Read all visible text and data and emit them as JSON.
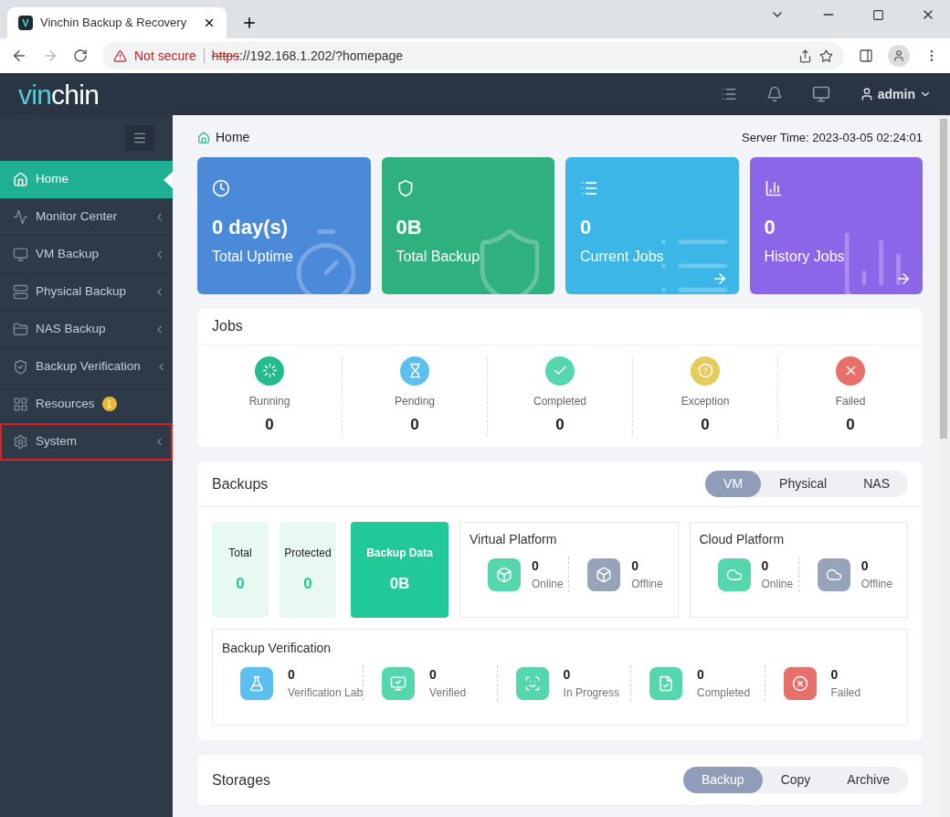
{
  "browser": {
    "tab_title": "Vinchin Backup & Recovery",
    "tab_icon_letter": "V",
    "security": "Not secure",
    "scheme": "https",
    "url_rest": "://192.168.1.202/?homepage"
  },
  "header": {
    "logo_accent": "vin",
    "logo_rest": "chin",
    "user": "admin"
  },
  "sidebar": {
    "items": [
      {
        "label": "Home",
        "selected": true,
        "highlighted": false,
        "expandable": false
      },
      {
        "label": "Monitor Center",
        "selected": false,
        "highlighted": false,
        "expandable": true
      },
      {
        "label": "VM Backup",
        "selected": false,
        "highlighted": false,
        "expandable": true
      },
      {
        "label": "Physical Backup",
        "selected": false,
        "highlighted": false,
        "expandable": true
      },
      {
        "label": "NAS Backup",
        "selected": false,
        "highlighted": false,
        "expandable": true
      },
      {
        "label": "Backup Verification",
        "selected": false,
        "highlighted": false,
        "expandable": true
      },
      {
        "label": "Resources",
        "selected": false,
        "highlighted": false,
        "expandable": false,
        "badge": "1"
      },
      {
        "label": "System",
        "selected": false,
        "highlighted": true,
        "expandable": true
      }
    ]
  },
  "breadcrumb": "Home",
  "server_time": "Server Time: 2023-03-05 02:24:01",
  "stat_cards": [
    {
      "kind": "uptime",
      "value": "0 day(s)",
      "label": "Total Uptime",
      "color": "#4a8ad8",
      "arrow": false
    },
    {
      "kind": "backup",
      "value": "0B",
      "label": "Total Backup",
      "color": "#2fb07f",
      "arrow": false
    },
    {
      "kind": "current",
      "value": "0",
      "label": "Current Jobs",
      "color": "#3bb6e6",
      "arrow": true
    },
    {
      "kind": "history",
      "value": "0",
      "label": "History Jobs",
      "color": "#8c66e8",
      "arrow": true
    }
  ],
  "jobs": {
    "title": "Jobs",
    "items": [
      {
        "kind": "running",
        "label": "Running",
        "value": "0",
        "color": "#22bb8c"
      },
      {
        "kind": "pending",
        "label": "Pending",
        "value": "0",
        "color": "#5bc0f0"
      },
      {
        "kind": "completed",
        "label": "Completed",
        "value": "0",
        "color": "#55d6ac"
      },
      {
        "kind": "exception",
        "label": "Exception",
        "value": "0",
        "color": "#e6cc5c"
      },
      {
        "kind": "failed",
        "label": "Failed",
        "value": "0",
        "color": "#e8706a"
      }
    ]
  },
  "backups": {
    "title": "Backups",
    "tabs": [
      {
        "label": "VM",
        "selected": true
      },
      {
        "label": "Physical",
        "selected": false
      },
      {
        "label": "NAS",
        "selected": false
      }
    ],
    "summary": [
      {
        "label": "Total",
        "value": "0",
        "highlight": false
      },
      {
        "label": "Protected",
        "value": "0",
        "highlight": false
      },
      {
        "label": "Backup Data",
        "value": "0B",
        "highlight": true
      }
    ],
    "platforms": [
      {
        "title": "Virtual Platform",
        "kind": "virtual",
        "items": [
          {
            "value": "0",
            "label": "Online",
            "color": "#55d6ac"
          },
          {
            "value": "0",
            "label": "Offline",
            "color": "#97a3b8"
          }
        ]
      },
      {
        "title": "Cloud Platform",
        "kind": "cloud",
        "items": [
          {
            "value": "0",
            "label": "Online",
            "color": "#55d6ac"
          },
          {
            "value": "0",
            "label": "Offline",
            "color": "#97a3b8"
          }
        ]
      }
    ],
    "verification": {
      "title": "Backup Verification",
      "items": [
        {
          "kind": "lab",
          "value": "0",
          "label": "Verification Lab",
          "color": "#5bc0f0"
        },
        {
          "kind": "vm",
          "value": "0",
          "label": "Verified",
          "color": "#55d6ac"
        },
        {
          "kind": "progress",
          "value": "0",
          "label": "In Progress",
          "color": "#55d6ac"
        },
        {
          "kind": "done",
          "value": "0",
          "label": "Completed",
          "color": "#55d6ac"
        },
        {
          "kind": "failed",
          "value": "0",
          "label": "Failed",
          "color": "#e8706a"
        }
      ]
    }
  },
  "storages": {
    "title": "Storages",
    "tabs": [
      {
        "label": "Backup",
        "selected": true
      },
      {
        "label": "Copy",
        "selected": false
      },
      {
        "label": "Archive",
        "selected": false
      }
    ]
  }
}
